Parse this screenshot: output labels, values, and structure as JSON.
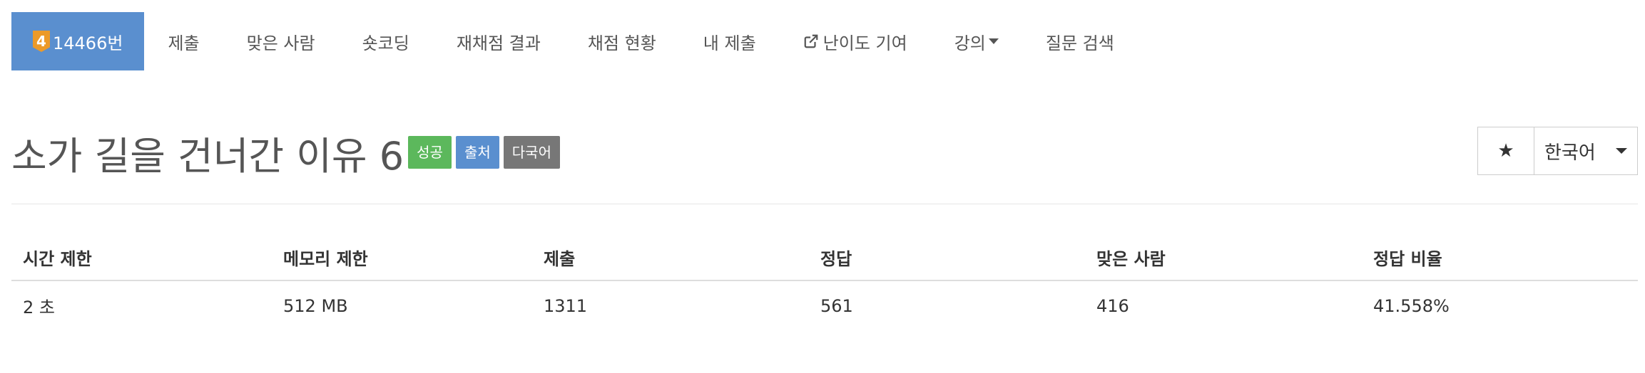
{
  "nav": {
    "tier": "4",
    "problem_number": "14466번",
    "items": [
      "제출",
      "맞은 사람",
      "숏코딩",
      "재채점 결과",
      "채점 현황",
      "내 제출",
      "난이도 기여",
      "강의",
      "질문 검색"
    ]
  },
  "problem": {
    "title": "소가 길을 건너간 이유 6",
    "labels": [
      "성공",
      "출처",
      "다국어"
    ]
  },
  "actions": {
    "star": "★",
    "language": "한국어"
  },
  "info_table": {
    "headers": [
      "시간 제한",
      "메모리 제한",
      "제출",
      "정답",
      "맞은 사람",
      "정답 비율"
    ],
    "row": [
      "2 초",
      "512 MB",
      "1311",
      "561",
      "416",
      "41.558%"
    ]
  },
  "colors": {
    "active_tab": "#5a8fcf",
    "tier_badge": "#ec9a29",
    "label_success": "#5cb85c",
    "label_source": "#5a8fcf",
    "label_multi": "#777777"
  },
  "icons": [
    "tier-badge-icon",
    "external-link-icon",
    "caret-down-icon",
    "star-icon"
  ]
}
